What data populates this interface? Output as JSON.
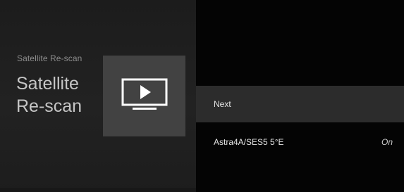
{
  "header": {
    "breadcrumb": "Satellite Re-scan",
    "title_line1": "Satellite",
    "title_line2": "Re-scan"
  },
  "tile": {
    "icon": "tv-play-icon"
  },
  "menu": {
    "items": [
      {
        "label": "Next",
        "selected": true
      },
      {
        "label": "Astra4A/SES5 5°E",
        "value": "On"
      }
    ]
  },
  "colors": {
    "background": "#000000",
    "left_panel": "#1f1f1f",
    "tile": "#424242",
    "selected_row": "#2c2c2c",
    "text_primary": "#e6e6e6",
    "text_secondary": "#8c8c8c"
  }
}
